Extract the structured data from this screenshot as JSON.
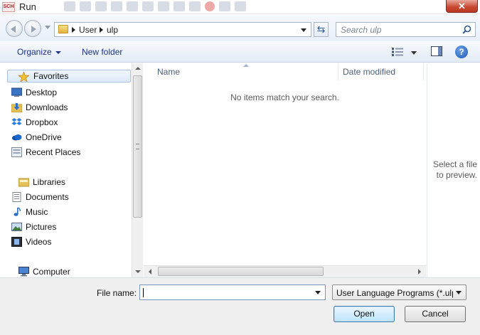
{
  "window": {
    "app_icon_text": "SCH",
    "title": "Run",
    "close_label": "✕"
  },
  "address_bar": {
    "crumbs": [
      "User",
      "ulp"
    ],
    "refresh_glyph": "⇆",
    "search_placeholder": "Search ulp"
  },
  "command_bar": {
    "organize_label": "Organize",
    "new_folder_label": "New folder",
    "help_glyph": "?"
  },
  "nav_pane": {
    "favorites": {
      "label": "Favorites",
      "items": [
        {
          "label": "Desktop",
          "icon": "desktop-icon"
        },
        {
          "label": "Downloads",
          "icon": "downloads-icon"
        },
        {
          "label": "Dropbox",
          "icon": "dropbox-icon"
        },
        {
          "label": "OneDrive",
          "icon": "onedrive-icon"
        },
        {
          "label": "Recent Places",
          "icon": "recent-places-icon"
        }
      ]
    },
    "libraries": {
      "label": "Libraries",
      "items": [
        {
          "label": "Documents",
          "icon": "documents-icon"
        },
        {
          "label": "Music",
          "icon": "music-icon"
        },
        {
          "label": "Pictures",
          "icon": "pictures-icon"
        },
        {
          "label": "Videos",
          "icon": "videos-icon"
        }
      ]
    },
    "computer": {
      "label": "Computer"
    }
  },
  "file_list": {
    "columns": [
      "Name",
      "Date modified"
    ],
    "empty_message": "No items match your search."
  },
  "preview": {
    "message": "Select a file to preview."
  },
  "footer": {
    "file_name_label": "File name:",
    "file_name_value": "",
    "filter_value": "User Language Programs (*.ulp",
    "open_label": "Open",
    "cancel_label": "Cancel"
  },
  "colors": {
    "accent_link": "#1e3287",
    "selection_border": "#a9c2e3",
    "close_button": "#c7462f"
  }
}
